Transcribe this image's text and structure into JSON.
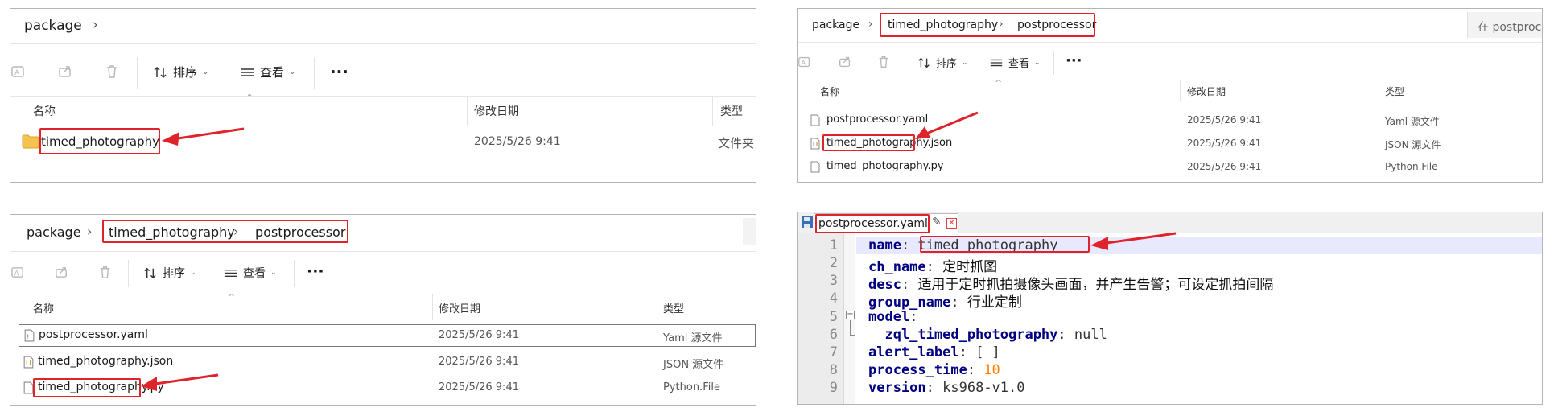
{
  "panel1": {
    "breadcrumb": [
      "package"
    ],
    "toolbar": {
      "sort": "排序",
      "view": "查看",
      "more": "···"
    },
    "columns": {
      "name": "名称",
      "date": "修改日期",
      "type": "类型"
    },
    "rows": [
      {
        "name": "timed_photography",
        "date": "2025/5/26 9:41",
        "type": "文件夹",
        "icon": "folder-icon"
      }
    ]
  },
  "panel2": {
    "breadcrumb": [
      "package",
      "timed_photography",
      "postprocessor"
    ],
    "search_placeholder": "在 postproce",
    "toolbar": {
      "sort": "排序",
      "view": "查看",
      "more": "···"
    },
    "columns": {
      "name": "名称",
      "date": "修改日期",
      "type": "类型"
    },
    "rows": [
      {
        "name": "postprocessor.yaml",
        "date": "2025/5/26 9:41",
        "type": "Yaml 源文件"
      },
      {
        "name": "timed_photography.json",
        "date": "2025/5/26 9:41",
        "type": "JSON 源文件"
      },
      {
        "name": "timed_photography.py",
        "date": "2025/5/26 9:41",
        "type": "Python.File"
      }
    ]
  },
  "panel3": {
    "breadcrumb": [
      "package",
      "timed_photography",
      "postprocessor"
    ],
    "toolbar": {
      "sort": "排序",
      "view": "查看",
      "more": "···"
    },
    "columns": {
      "name": "名称",
      "date": "修改日期",
      "type": "类型"
    },
    "rows": [
      {
        "name": "postprocessor.yaml",
        "date": "2025/5/26 9:41",
        "type": "Yaml 源文件"
      },
      {
        "name": "timed_photography.json",
        "date": "2025/5/26 9:41",
        "type": "JSON 源文件"
      },
      {
        "name": "timed_photography.py",
        "date": "2025/5/26 9:41",
        "type": "Python.File"
      }
    ]
  },
  "editor": {
    "tab_title": "postprocessor.yaml",
    "lines": [
      {
        "n": "1",
        "key": "name",
        "sep": ": ",
        "val": "timed_photography"
      },
      {
        "n": "2",
        "key": "ch_name",
        "sep": ": ",
        "val": "定时抓图"
      },
      {
        "n": "3",
        "key": "desc",
        "sep": ": ",
        "val": "适用于定时抓拍摄像头画面，并产生告警；可设定抓拍间隔"
      },
      {
        "n": "4",
        "key": "group_name",
        "sep": ": ",
        "val": "行业定制"
      },
      {
        "n": "5",
        "key": "model",
        "sep": ":",
        "val": ""
      },
      {
        "n": "6",
        "key": "  zql_timed_photography",
        "sep": ": ",
        "val": "null"
      },
      {
        "n": "7",
        "key": "alert_label",
        "sep": ": ",
        "val": "[ ]"
      },
      {
        "n": "8",
        "key": "process_time",
        "sep": ": ",
        "val": "10"
      },
      {
        "n": "9",
        "key": "version",
        "sep": ": ",
        "val": "ks968-v1.0"
      }
    ]
  },
  "colors": {
    "highlight": "#e0232a",
    "yaml_key": "#000080",
    "yaml_number": "#ff8000",
    "folder": "#f4c24f"
  }
}
